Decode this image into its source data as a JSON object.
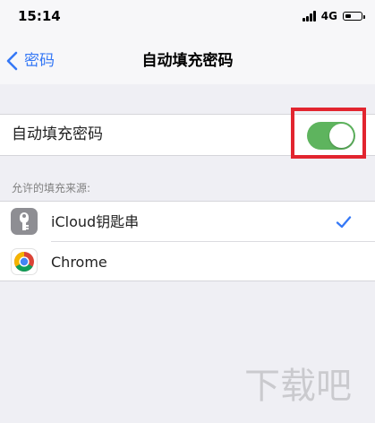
{
  "status_bar": {
    "time": "15:14",
    "network": "4G",
    "battery_level": 0.4
  },
  "nav": {
    "back_label": "密码",
    "title": "自动填充密码"
  },
  "autofill": {
    "label": "自动填充密码",
    "enabled": true
  },
  "sources": {
    "header": "允许的填充来源:",
    "items": [
      {
        "name": "iCloud钥匙串",
        "icon": "key-icon",
        "checked": true
      },
      {
        "name": "Chrome",
        "icon": "chrome-icon",
        "checked": false
      }
    ]
  },
  "watermark_text": "下载吧",
  "colors": {
    "accent": "#3578f6",
    "switch_on": "#5eb45e",
    "highlight": "#e2252f",
    "background": "#efeff4"
  }
}
